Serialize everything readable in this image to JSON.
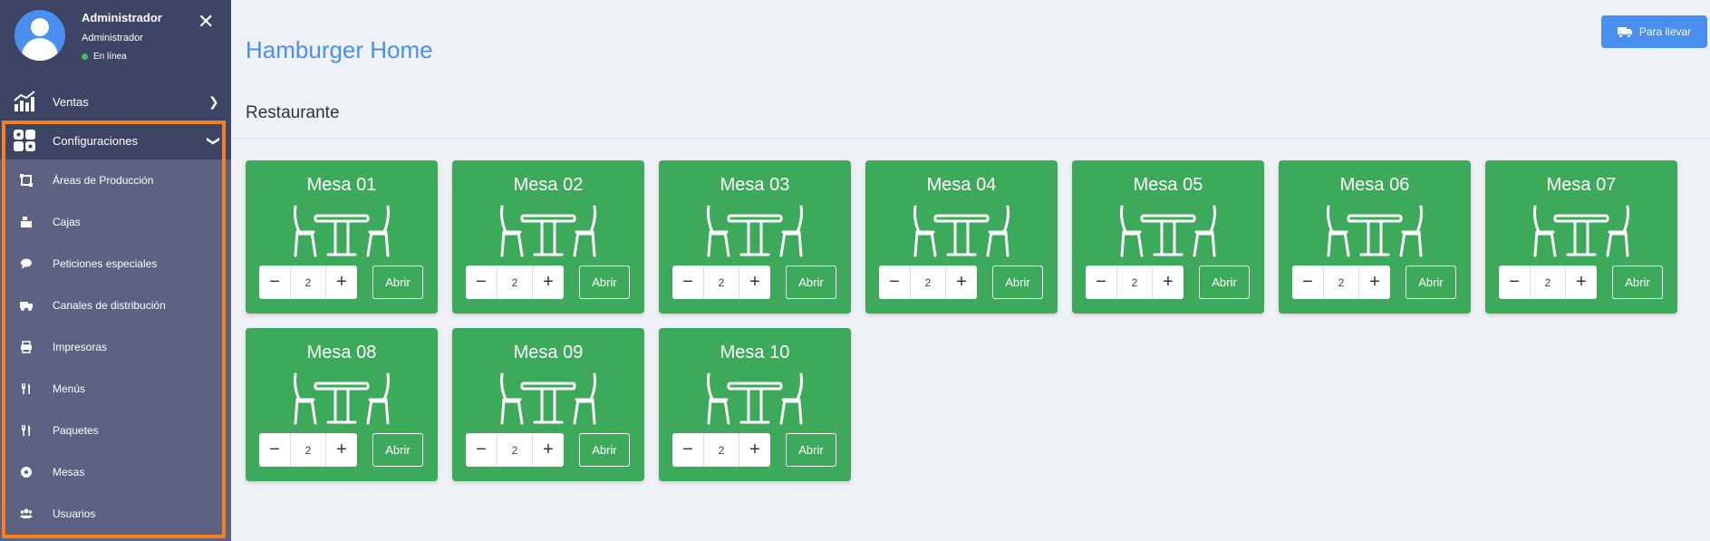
{
  "user": {
    "name": "Administrador",
    "role": "Administrador",
    "status": "En línea"
  },
  "nav": {
    "ventas": "Ventas",
    "configuraciones": "Configuraciones",
    "submenu": [
      {
        "label": "Áreas de Producción",
        "icon": "production-area-icon"
      },
      {
        "label": "Cajas",
        "icon": "cash-register-icon"
      },
      {
        "label": "Peticiones especiales",
        "icon": "comment-icon"
      },
      {
        "label": "Canales de distribución",
        "icon": "truck-icon"
      },
      {
        "label": "Impresoras",
        "icon": "printer-icon"
      },
      {
        "label": "Menús",
        "icon": "utensils-icon"
      },
      {
        "label": "Paquetes",
        "icon": "utensils-icon"
      },
      {
        "label": "Mesas",
        "icon": "circle-icon"
      },
      {
        "label": "Usuarios",
        "icon": "users-icon"
      }
    ]
  },
  "header": {
    "title": "Hamburger Home",
    "takeaway_button": "Para llevar"
  },
  "section": {
    "title": "Restaurante"
  },
  "tables": [
    {
      "name": "Mesa 01",
      "guests": "2",
      "open_label": "Abrir"
    },
    {
      "name": "Mesa 02",
      "guests": "2",
      "open_label": "Abrir"
    },
    {
      "name": "Mesa 03",
      "guests": "2",
      "open_label": "Abrir"
    },
    {
      "name": "Mesa 04",
      "guests": "2",
      "open_label": "Abrir"
    },
    {
      "name": "Mesa 05",
      "guests": "2",
      "open_label": "Abrir"
    },
    {
      "name": "Mesa 06",
      "guests": "2",
      "open_label": "Abrir"
    },
    {
      "name": "Mesa 07",
      "guests": "2",
      "open_label": "Abrir"
    },
    {
      "name": "Mesa 08",
      "guests": "2",
      "open_label": "Abrir"
    },
    {
      "name": "Mesa 09",
      "guests": "2",
      "open_label": "Abrir"
    },
    {
      "name": "Mesa 10",
      "guests": "2",
      "open_label": "Abrir"
    }
  ],
  "colors": {
    "sidebar": "#5d6182",
    "sidebar_dark": "#3d4466",
    "accent": "#4a8ff0",
    "table_card": "#3daa5b",
    "highlight": "#f5821f",
    "online": "#3fbf6a"
  }
}
